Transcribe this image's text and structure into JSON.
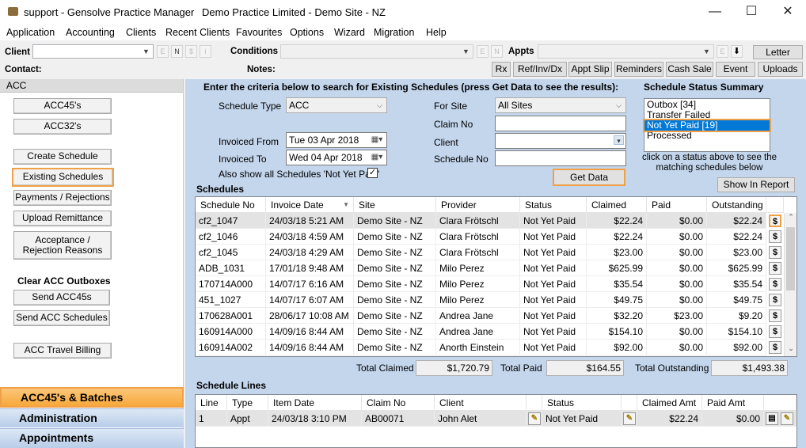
{
  "window": {
    "title": "support - Gensolve Practice Manager",
    "subtitle": "Demo Practice Limited - Demo Site - NZ",
    "min": "—",
    "max": "☐",
    "close": "✕"
  },
  "menu": [
    "Application",
    "Accounting",
    "Clients",
    "Recent Clients",
    "Favourites",
    "Options",
    "Wizard",
    "Migration",
    "Help"
  ],
  "toolbar": {
    "client_label": "Client",
    "conditions_label": "Conditions",
    "appts_label": "Appts",
    "letter": "Letter",
    "contact_label": "Contact:",
    "notes_label": "Notes:",
    "mini_e": "E",
    "mini_n": "N",
    "mini_s": "$",
    "mini_i": "i",
    "buttons": [
      "Rx",
      "Ref/Inv/Dx",
      "Appt Slip",
      "Reminders",
      "Cash Sale",
      "Event",
      "Uploads"
    ]
  },
  "left": {
    "header": "ACC",
    "buttons": [
      "ACC45's",
      "ACC32's",
      "Create Schedule",
      "Existing Schedules",
      "Payments / Rejections",
      "Upload Remittance",
      "Acceptance / Rejection Reasons"
    ],
    "clear_heading": "Clear ACC Outboxes",
    "clear_buttons": [
      "Send ACC45s",
      "Send ACC Schedules"
    ],
    "travel": "ACC Travel Billing",
    "nav": [
      "ACC45's & Batches",
      "Administration",
      "Appointments"
    ]
  },
  "criteria": {
    "heading": "Enter the criteria below to search for Existing Schedules (press Get Data to see the results):",
    "schedule_type_label": "Schedule Type",
    "schedule_type": "ACC",
    "invoiced_from_label": "Invoiced From",
    "invoiced_from": "Tue 03 Apr 2018",
    "invoiced_to_label": "Invoiced To",
    "invoiced_to": "Wed 04 Apr 2018",
    "also_show": "Also show all Schedules 'Not Yet Paid'",
    "also_show_checked": true,
    "for_site_label": "For Site",
    "for_site": "All Sites",
    "claim_no_label": "Claim No",
    "client_label": "Client",
    "schedule_no_label": "Schedule No",
    "get_data": "Get Data"
  },
  "summary": {
    "heading": "Schedule Status Summary",
    "items": [
      "Outbox  [34]",
      "Transfer Failed",
      "Not Yet Paid  [19]",
      "Processed"
    ],
    "selected_index": 2,
    "hint": "click on a status above to see the matching schedules below",
    "show_report": "Show In Report"
  },
  "schedules": {
    "heading": "Schedules",
    "columns": [
      "Schedule No",
      "Invoice Date",
      "Site",
      "Provider",
      "Status",
      "Claimed",
      "Paid",
      "Outstanding"
    ],
    "rows": [
      [
        "cf2_1047",
        "24/03/18 5:21 AM",
        "Demo Site - NZ",
        "Clara Frötschl",
        "Not Yet Paid",
        "$22.24",
        "$0.00",
        "$22.24"
      ],
      [
        "cf2_1046",
        "24/03/18 4:59 AM",
        "Demo Site - NZ",
        "Clara Frötschl",
        "Not Yet Paid",
        "$22.24",
        "$0.00",
        "$22.24"
      ],
      [
        "cf2_1045",
        "24/03/18 4:29 AM",
        "Demo Site - NZ",
        "Clara Frötschl",
        "Not Yet Paid",
        "$23.00",
        "$0.00",
        "$23.00"
      ],
      [
        "ADB_1031",
        "17/01/18 9:48 AM",
        "Demo Site - NZ",
        "Milo Perez",
        "Not Yet Paid",
        "$625.99",
        "$0.00",
        "$625.99"
      ],
      [
        "170714A000",
        "14/07/17 6:16 AM",
        "Demo Site - NZ",
        "Milo Perez",
        "Not Yet Paid",
        "$35.54",
        "$0.00",
        "$35.54"
      ],
      [
        "451_1027",
        "14/07/17 6:07 AM",
        "Demo Site - NZ",
        "Milo Perez",
        "Not Yet Paid",
        "$49.75",
        "$0.00",
        "$49.75"
      ],
      [
        "170628A001",
        "28/06/17 10:08 AM",
        "Demo Site - NZ",
        "Andrea Jane",
        "Not Yet Paid",
        "$32.20",
        "$23.00",
        "$9.20"
      ],
      [
        "160914A000",
        "14/09/16 8:44 AM",
        "Demo Site - NZ",
        "Andrea Jane",
        "Not Yet Paid",
        "$154.10",
        "$0.00",
        "$154.10"
      ],
      [
        "160914A002",
        "14/09/16 8:44 AM",
        "Demo Site - NZ",
        "Anorth Einstein",
        "Not Yet Paid",
        "$92.00",
        "$0.00",
        "$92.00"
      ]
    ],
    "dollar": "$",
    "total_claimed_label": "Total Claimed",
    "total_claimed": "$1,720.79",
    "total_paid_label": "Total Paid",
    "total_paid": "$164.55",
    "total_outstanding_label": "Total Outstanding",
    "total_outstanding": "$1,493.38"
  },
  "lines": {
    "heading": "Schedule Lines",
    "columns": [
      "Line",
      "Type",
      "Item Date",
      "Claim No",
      "Client",
      "Status",
      "Claimed Amt",
      "Paid Amt"
    ],
    "rows": [
      [
        "1",
        "Appt",
        "24/03/18 3:10 PM",
        "AB00071",
        "John Alet",
        "Not Yet Paid",
        "$22.24",
        "$0.00"
      ]
    ]
  }
}
